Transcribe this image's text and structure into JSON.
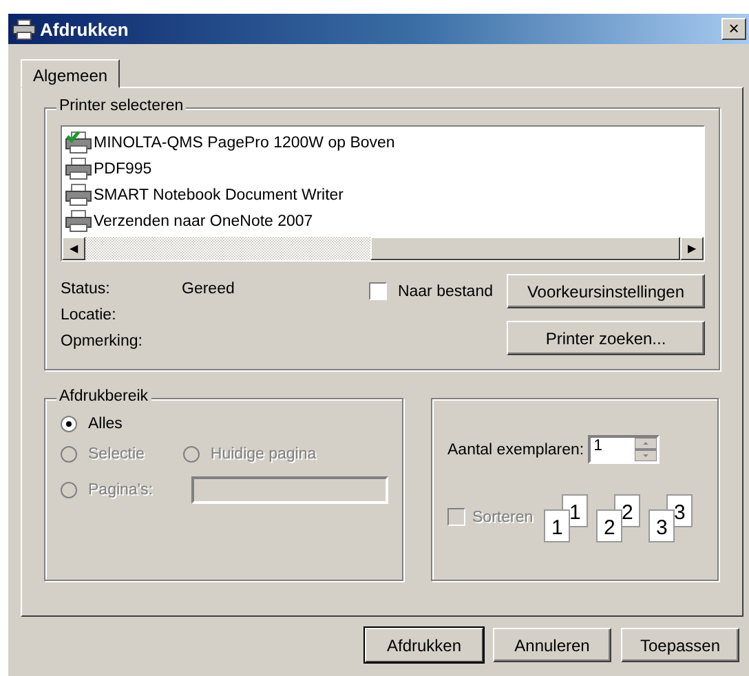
{
  "window": {
    "title": "Afdrukken",
    "close": "×"
  },
  "tabs": [
    {
      "label": "Algemeen",
      "selected": true
    }
  ],
  "printer_group": {
    "title": "Printer selecteren",
    "printers": [
      {
        "name": "MINOLTA-QMS PagePro 1200W op Boven",
        "default": true
      },
      {
        "name": "PDF995",
        "default": false
      },
      {
        "name": "SMART Notebook Document Writer",
        "default": false
      },
      {
        "name": "Verzenden naar OneNote 2007",
        "default": false
      }
    ],
    "scroll_left": "◀",
    "scroll_right": "▶",
    "info": [
      {
        "label": "Status:",
        "value": "Gereed"
      },
      {
        "label": "Locatie:"
      },
      {
        "label": "Opmerking:"
      }
    ],
    "to_file": {
      "label": "Naar bestand",
      "checked": false,
      "disabled": false
    },
    "buttons": [
      "Voorkeursinstellingen",
      "Printer zoeken..."
    ]
  },
  "range_group": {
    "title": "Afdrukbereik",
    "options": [
      {
        "label": "Alles",
        "selected": true,
        "disabled": false
      },
      {
        "label": "Selectie",
        "selected": false,
        "disabled": true
      },
      {
        "label": "Huidige pagina",
        "selected": false,
        "disabled": true
      },
      {
        "label": "Pagina's:",
        "selected": false,
        "disabled": true
      }
    ]
  },
  "copies_group": {
    "copies_label": "Aantal exemplaren:",
    "copies_value": "1",
    "collate": {
      "label": "Sorteren",
      "checked": false,
      "disabled": true
    },
    "collate_pages": [
      {
        "back": "1",
        "front": "1"
      },
      {
        "back": "2",
        "front": "2"
      },
      {
        "back": "3",
        "front": "3"
      }
    ]
  },
  "footer_buttons": [
    {
      "label": "Afdrukken",
      "default": true
    },
    {
      "label": "Annuleren",
      "default": false
    },
    {
      "label": "Toepassen",
      "default": false
    }
  ]
}
